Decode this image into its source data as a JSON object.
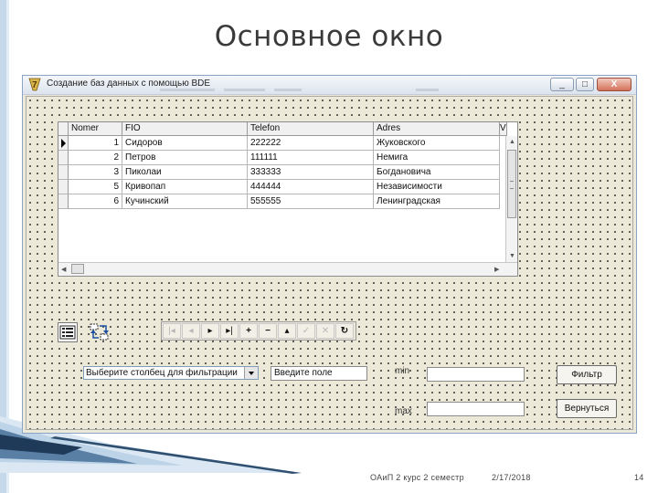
{
  "slide": {
    "title": "Основное окно",
    "footer": {
      "left": "ОАиП 2 курс 2 семестр",
      "date": "2/17/2018",
      "page": "14"
    }
  },
  "window": {
    "title": "Создание баз данных с помощью BDE",
    "buttons": {
      "minimize": "_",
      "maximize": "□",
      "close": "X"
    }
  },
  "grid": {
    "columns": [
      "Nomer",
      "FIO",
      "Telefon",
      "Adres",
      "V"
    ],
    "rows": [
      {
        "nomer": "1",
        "fio": "Сидоров",
        "telefon": "222222",
        "adres": "Жуковского"
      },
      {
        "nomer": "2",
        "fio": "Петров",
        "telefon": "111111",
        "adres": "Немига"
      },
      {
        "nomer": "3",
        "fio": "Пиколаи",
        "telefon": "333333",
        "adres": "Богдановича"
      },
      {
        "nomer": "5",
        "fio": "Кривопап",
        "telefon": "444444",
        "adres": "Независимости"
      },
      {
        "nomer": "6",
        "fio": "Кучинский",
        "telefon": "555555",
        "adres": "Ленинградская"
      }
    ],
    "selected_row": 0
  },
  "navigator": {
    "buttons": [
      "first",
      "prior",
      "next",
      "last",
      "insert",
      "delete",
      "edit",
      "post",
      "cancel",
      "refresh"
    ],
    "glyphs": [
      "|◂",
      "◂",
      "▸",
      "▸|",
      "+",
      "−",
      "▴",
      "✓",
      "✕",
      "↻"
    ],
    "enabled": [
      false,
      false,
      true,
      true,
      true,
      true,
      true,
      false,
      false,
      true
    ]
  },
  "filter": {
    "combo_text": "Выберите столбец для фильтрации",
    "field_text": "Введите поле",
    "min_label": "min",
    "max_label": "max",
    "min_value": "",
    "max_value": "",
    "filter_button": "Фильтр",
    "return_button": "Вернуться"
  }
}
